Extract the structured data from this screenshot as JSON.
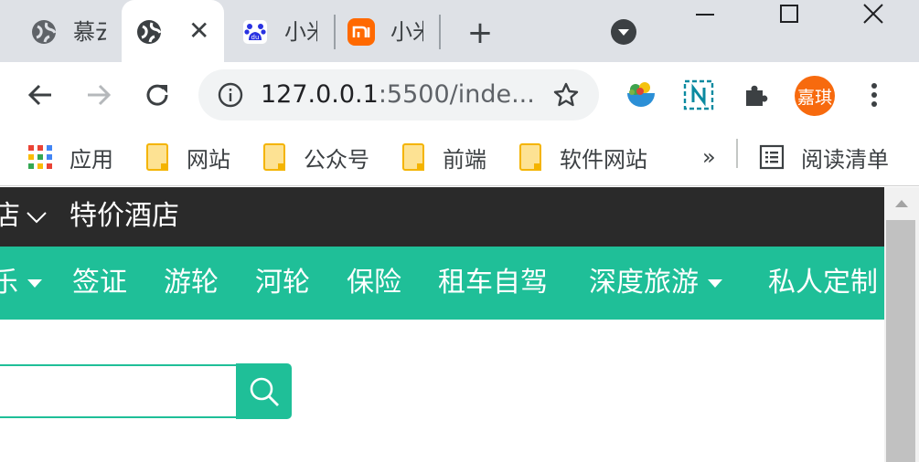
{
  "browser": {
    "tabs": [
      {
        "title": "慕云",
        "favicon": "globe-icon",
        "active": false
      },
      {
        "title": "",
        "favicon": "globe-icon",
        "active": true
      },
      {
        "title": "小米",
        "favicon": "baidu-paw-icon",
        "active": false
      },
      {
        "title": "小米",
        "favicon": "mi-logo-icon",
        "active": false
      }
    ],
    "new_tab_glyph": "+",
    "close_glyph": "✕",
    "url_host": "127.0.0.1",
    "url_rest": ":5500/inde...",
    "profile_initials": "嘉琪",
    "profile_color": "#f76a0e",
    "bookmarks": [
      {
        "label": "应用",
        "icon": "apps-grid-icon"
      },
      {
        "label": "网站",
        "icon": "folder-icon"
      },
      {
        "label": "公众号",
        "icon": "folder-icon"
      },
      {
        "label": "前端",
        "icon": "folder-icon"
      },
      {
        "label": "软件网站",
        "icon": "folder-icon"
      }
    ],
    "bookmarks_overflow": "»",
    "reading_list": "阅读清单"
  },
  "site": {
    "accent_color": "#1fbf98",
    "topbar": {
      "items": [
        "店",
        "特价酒店"
      ]
    },
    "nav": {
      "items": [
        "乐",
        "签证",
        "游轮",
        "河轮",
        "保险",
        "租车自驾",
        "深度旅游",
        "私人定制"
      ]
    },
    "search": {
      "placeholder": "",
      "value": ""
    }
  }
}
